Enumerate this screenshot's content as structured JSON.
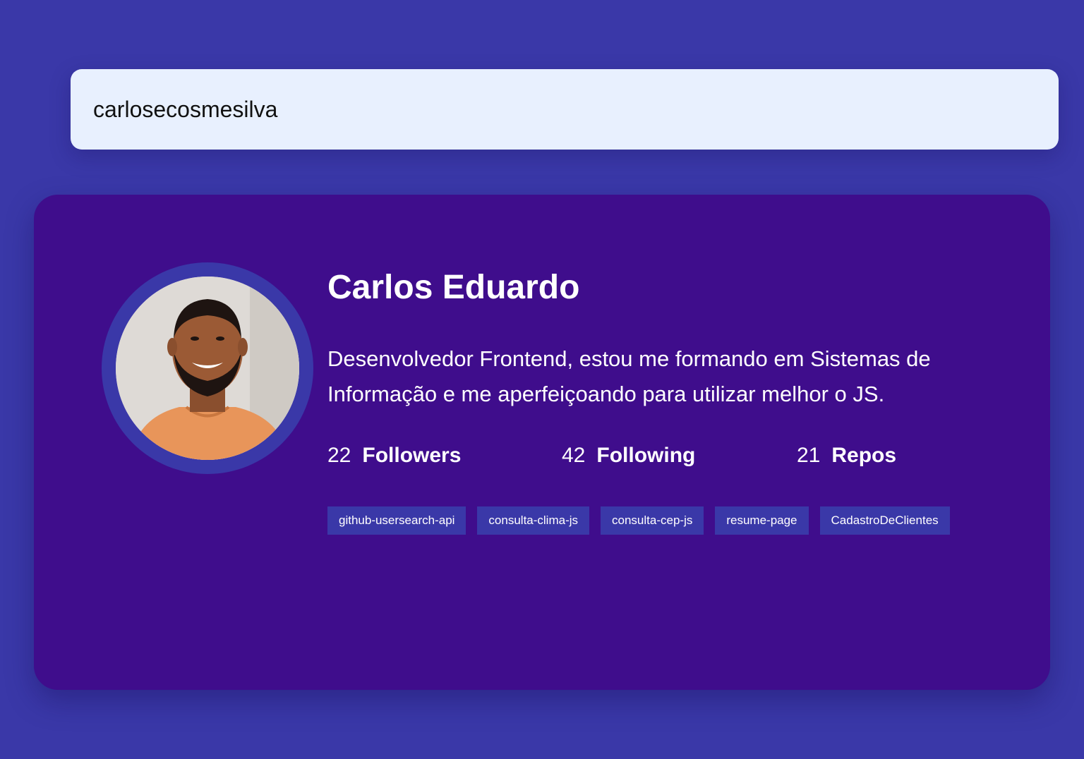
{
  "search": {
    "value": "carlosecosmesilva"
  },
  "profile": {
    "name": "Carlos Eduardo",
    "bio": "Desenvolvedor Frontend, estou me formando em Sistemas de Informação e me aperfeiçoando para utilizar melhor o JS.",
    "avatar_icon": "user-avatar-photo",
    "stats": {
      "followers_count": "22",
      "followers_label": "Followers",
      "following_count": "42",
      "following_label": "Following",
      "repos_count": "21",
      "repos_label": "Repos"
    },
    "repos": [
      "github-usersearch-api",
      "consulta-clima-js",
      "consulta-cep-js",
      "resume-page",
      "CadastroDeClientes"
    ]
  },
  "colors": {
    "background": "#3a38a8",
    "card": "#3f0d8c",
    "search_bg": "#e8f0fe",
    "tag_bg": "#3a38a8",
    "text": "#ffffff"
  }
}
